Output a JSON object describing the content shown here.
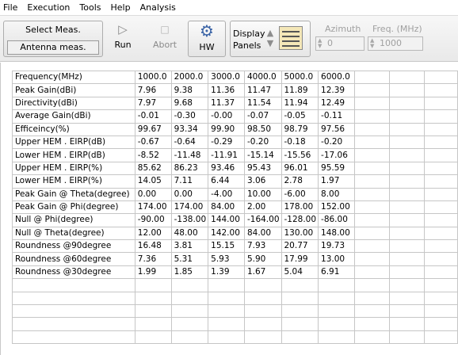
{
  "menu": [
    "File",
    "Execution",
    "Tools",
    "Help",
    "Analysis"
  ],
  "toolbar": {
    "select_meas_label": "Select Meas.",
    "antenna_meas_label": "Antenna meas.",
    "run_label": "Run",
    "abort_label": "Abort",
    "hw_label": "HW",
    "display_label": "Display",
    "panels_label": "Panels",
    "azimuth_label": "Azimuth",
    "azimuth_value": "0",
    "freq_label": "Freq. (MHz)",
    "freq_value": "1000"
  },
  "colors": {
    "hw_gear": "#3a63a6",
    "panel_icon": "#f4e7b8",
    "disabled_text": "#a0a0a0"
  },
  "table": {
    "header": [
      "Frequency(MHz)",
      "1000.0",
      "2000.0",
      "3000.0",
      "4000.0",
      "5000.0",
      "6000.0"
    ],
    "rows": [
      [
        "Peak Gain(dBi)",
        "7.96",
        "9.38",
        "11.36",
        "11.47",
        "11.89",
        "12.39"
      ],
      [
        "Directivity(dBi)",
        "7.97",
        "9.68",
        "11.37",
        "11.54",
        "11.94",
        "12.49"
      ],
      [
        "Average Gain(dBi)",
        "-0.01",
        "-0.30",
        "-0.00",
        "-0.07",
        "-0.05",
        "-0.11"
      ],
      [
        "Efficeincy(%)",
        "99.67",
        "93.34",
        "99.90",
        "98.50",
        "98.79",
        "97.56"
      ],
      [
        "Upper HEM . EIRP(dB)",
        "-0.67",
        "-0.64",
        "-0.29",
        "-0.20",
        "-0.18",
        "-0.20"
      ],
      [
        "Lower HEM . EIRP(dB)",
        "-8.52",
        "-11.48",
        "-11.91",
        "-15.14",
        "-15.56",
        "-17.06"
      ],
      [
        "Upper HEM . EIRP(%)",
        "85.62",
        "86.23",
        "93.46",
        "95.43",
        "96.01",
        "95.59"
      ],
      [
        "Lower HEM . EIRP(%)",
        "14.05",
        "7.11",
        "6.44",
        "3.06",
        "2.78",
        "1.97"
      ],
      [
        "Peak Gain @ Theta(degree)",
        "0.00",
        "0.00",
        "-4.00",
        "10.00",
        "-6.00",
        "8.00"
      ],
      [
        "Peak Gain @ Phi(degree)",
        "174.00",
        "174.00",
        "84.00",
        "2.00",
        "178.00",
        "152.00"
      ],
      [
        "Null @ Phi(degree)",
        "-90.00",
        "-138.00",
        "144.00",
        "-164.00",
        "-128.00",
        "-86.00"
      ],
      [
        "Null @ Theta(degree)",
        "12.00",
        "48.00",
        "142.00",
        "84.00",
        "130.00",
        "148.00"
      ],
      [
        "Roundness @90degree",
        "16.48",
        "3.81",
        "15.15",
        "7.93",
        "20.77",
        "19.73"
      ],
      [
        "Roundness @60degree",
        "7.36",
        "5.31",
        "5.93",
        "5.90",
        "17.99",
        "13.00"
      ],
      [
        "Roundness @30degree",
        "1.99",
        "1.85",
        "1.39",
        "1.67",
        "5.04",
        "6.91"
      ]
    ],
    "empty_rows": 5,
    "empty_cols": 3
  }
}
